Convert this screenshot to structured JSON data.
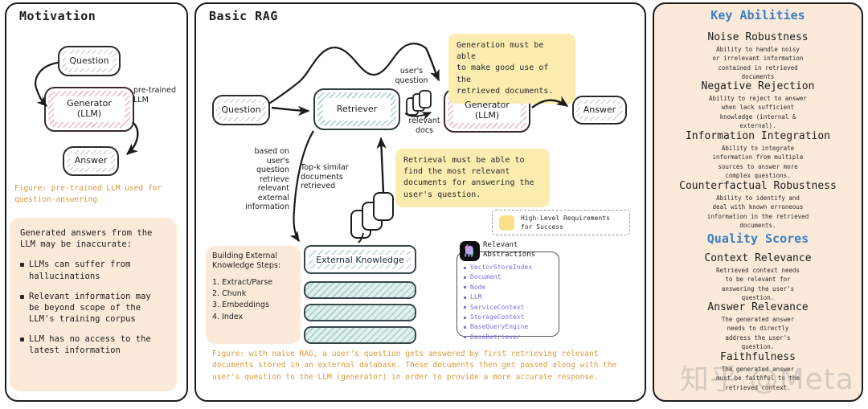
{
  "motivation": {
    "title": "Motivation",
    "nodes": {
      "question": "Question",
      "generator": "Generator\n(LLM)",
      "answer": "Answer"
    },
    "annotation": "pre-trained\nLLM",
    "caption": "Figure: pre-trained LLM used for\nquestion-answering",
    "card_lead": "Generated answers from the\nLLM may be inaccurate:",
    "bullets": [
      "LLMs can suffer from\nhallucinations",
      "Relevant information may\nbe beyond scope of the\nLLM's training corpus",
      "LLM has no access to the\nlatest information"
    ]
  },
  "rag": {
    "title": "Basic RAG",
    "nodes": {
      "question": "Question",
      "retriever": "Retriever",
      "generator": "Generator\n(LLM)",
      "answer": "Answer",
      "external_knowledge": "External Knowledge"
    },
    "annotations": {
      "users_question": "user's\nquestion",
      "relevant_docs": "relevant\ndocs",
      "based_on": "based on\nuser's\nquestion\nretrieve\nrelevant\nexternal\ninformation",
      "topk": "Top-k similar\ndocuments\nretrieved"
    },
    "stickies": [
      "Generation must be able\nto make good use of the\nretrieved documents.",
      "Retrieval must be able to\nfind the most relevant\ndocuments for answering the\nuser's question."
    ],
    "legend": "High-Level Requirements\nfor Success",
    "steps": {
      "heading": "Building External\nKnowledge Steps:",
      "items": [
        "1. Extract/Parse",
        "2. Chunk",
        "3. Embeddings",
        "4. Index"
      ]
    },
    "abstractions": {
      "label": "Relevant\nAbstractions",
      "icon": "llama-icon",
      "items": [
        "VectorStoreIndex",
        "Document",
        "Node",
        "LLM",
        "ServiceContext",
        "StorageContext",
        "BaseQueryEngine",
        "BaseRetriever"
      ]
    },
    "caption": "Figure: with naive RAG, a user's question gets answered by first retrieving relevant\ndocuments stored in an external database. These documents then get passed along with the\nuser's question to the LLM (generator) in order to provide a more accurate response."
  },
  "abilities": {
    "key_abilities_heading": "Key Abilities",
    "key_abilities": [
      {
        "title": "Noise Robustness",
        "desc": "Ability to handle noisy\nor irrelevant information\ncontained in retrieved\ndocuments"
      },
      {
        "title": "Negative Rejection",
        "desc": "Ability to reject to answer\nwhen lack sufficient\nknowledge (internal &\nexternal)."
      },
      {
        "title": "Information Integration",
        "desc": "Ability to integrate\ninformation from multiple\nsources to answer more\ncomplex questions."
      },
      {
        "title": "Counterfactual Robustness",
        "desc": "Ability to identify and\ndeal with known erroneous\ninformation in the retrieved\ndocuments."
      }
    ],
    "quality_scores_heading": "Quality Scores",
    "quality_scores": [
      {
        "title": "Context Relevance",
        "desc": "Retrieved context needs\nto be relevant for\nanswering the user's\nquestion."
      },
      {
        "title": "Answer Relevance",
        "desc": "The generated answer\nneeds to directly\naddress the user's\nquestion."
      },
      {
        "title": "Faithfulness",
        "desc": "The generated answer\nmust be faithful to the\nretrieved context."
      }
    ]
  },
  "watermark": "知乎 @Meta",
  "colors": {
    "panel_border": "#1c1c1c",
    "cream": "#fbeada",
    "sticky_yellow": "#fcecb0",
    "caption_orange": "#d99a3c",
    "heading_blue": "#3a7fc4",
    "abstraction_purple": "#7b6fe0",
    "teal_hatch": "#6ea5a5",
    "pink_hatch": "#cd788c"
  }
}
